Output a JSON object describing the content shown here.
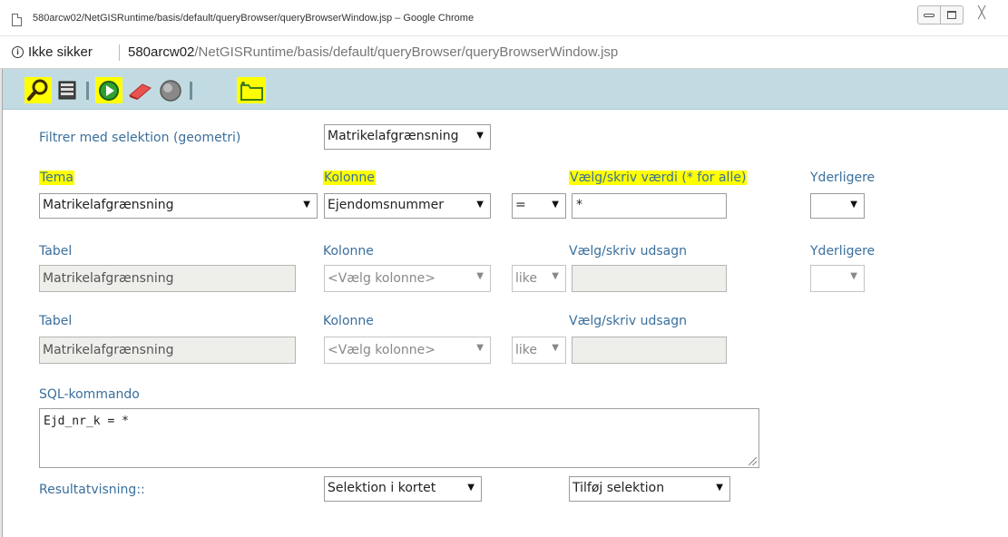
{
  "window": {
    "title": "580arcw02/NetGISRuntime/basis/default/queryBrowser/queryBrowserWindow.jsp – Google Chrome",
    "close_glyph": "╳"
  },
  "address_bar": {
    "security_label": "Ikke sikker",
    "url_host": "580arcw02",
    "url_path": "/NetGISRuntime/basis/default/queryBrowser/queryBrowserWindow.jsp"
  },
  "toolbar": {
    "buttons": [
      {
        "icon": "magnifier-icon",
        "active": true
      },
      {
        "icon": "table-icon",
        "active": false
      },
      {
        "icon": "play-icon",
        "active": false
      },
      {
        "icon": "eraser-icon",
        "active": false
      },
      {
        "icon": "globe-icon",
        "active": false
      },
      {
        "icon": "polygon-select-icon",
        "active": true
      }
    ],
    "colors": {
      "background": "#c2dbe2",
      "active": "#ffff00",
      "play": "#2fa02f",
      "eraser": "#e8534f"
    }
  },
  "form": {
    "filter_label": "Filtrer med selektion (geometri)",
    "filter_value": "Matrikelafgrænsning",
    "row1": {
      "tema_label": "Tema",
      "tema_value": "Matrikelafgrænsning",
      "kolonne_label": "Kolonne",
      "kolonne_value": "Ejendomsnummer",
      "operator_value": "=",
      "vaerdi_label": "Vælg/skriv værdi (* for alle)",
      "vaerdi_value": "*",
      "yderligere_label": "Yderligere",
      "yderligere_value": ""
    },
    "row2": {
      "tabel_label": "Tabel",
      "tabel_value": "Matrikelafgrænsning",
      "kolonne_label": "Kolonne",
      "kolonne_value": "<Vælg kolonne>",
      "operator_value": "like",
      "udsagn_label": "Vælg/skriv udsagn",
      "udsagn_value": "",
      "yderligere_label": "Yderligere",
      "yderligere_value": ""
    },
    "row3": {
      "tabel_label": "Tabel",
      "tabel_value": "Matrikelafgrænsning",
      "kolonne_label": "Kolonne",
      "kolonne_value": "<Vælg kolonne>",
      "operator_value": "like",
      "udsagn_label": "Vælg/skriv udsagn",
      "udsagn_value": ""
    },
    "sql_label": "SQL-kommando",
    "sql_value": "Ejd_nr_k = *",
    "result_label": "Resultatvisning::",
    "result_display_value": "Selektion i kortet",
    "result_action_value": "Tilføj selektion"
  }
}
